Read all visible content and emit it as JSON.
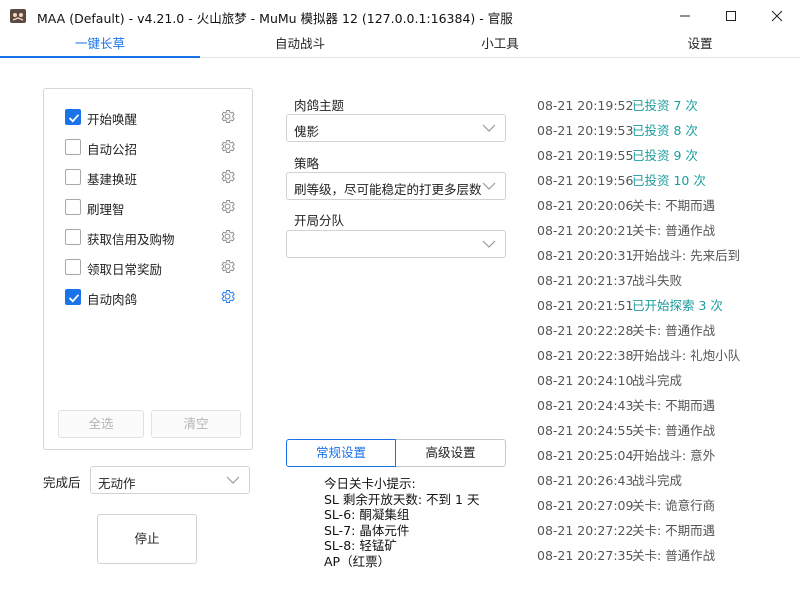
{
  "window": {
    "title": "MAA (Default) - v4.21.0 - 火山旅梦 - MuMu 模拟器 12 (127.0.0.1:16384) - 官服"
  },
  "tabs": [
    {
      "label": "一键长草",
      "active": true
    },
    {
      "label": "自动战斗"
    },
    {
      "label": "小工具"
    },
    {
      "label": "设置"
    }
  ],
  "tasks": [
    {
      "label": "开始唤醒",
      "checked": true
    },
    {
      "label": "自动公招",
      "checked": false
    },
    {
      "label": "基建换班",
      "checked": false
    },
    {
      "label": "刷理智",
      "checked": false
    },
    {
      "label": "获取信用及购物",
      "checked": false
    },
    {
      "label": "领取日常奖励",
      "checked": false
    },
    {
      "label": "自动肉鸽",
      "checked": true
    }
  ],
  "task_buttons": {
    "select_all": "全选",
    "clear": "清空"
  },
  "after_completion": {
    "label": "完成后",
    "value": "无动作"
  },
  "stop_button": "停止",
  "roguelike": {
    "theme_label": "肉鸽主题",
    "theme_value": "傀影",
    "strategy_label": "策略",
    "strategy_value": "刷等级，尽可能稳定的打更多层数",
    "squad_label": "开局分队",
    "squad_value": ""
  },
  "settings_tabs": {
    "normal": "常规设置",
    "advanced": "高级设置"
  },
  "tips": {
    "title": "今日关卡小提示:",
    "lines": [
      "SL 剩余开放天数: 不到 1 天",
      "SL-6: 酮凝集组",
      "SL-7: 晶体元件",
      "SL-8: 轻锰矿",
      "AP（红票）"
    ]
  },
  "log": [
    {
      "time": "08-21  20:19:52",
      "msg": "已投资 7 次",
      "highlight": true
    },
    {
      "time": "08-21  20:19:53",
      "msg": "已投资 8 次",
      "highlight": true
    },
    {
      "time": "08-21  20:19:55",
      "msg": "已投资 9 次",
      "highlight": true
    },
    {
      "time": "08-21  20:19:56",
      "msg": "已投资 10 次",
      "highlight": true
    },
    {
      "time": "08-21  20:20:06",
      "msg": "关卡: 不期而遇",
      "highlight": false
    },
    {
      "time": "08-21  20:20:21",
      "msg": "关卡: 普通作战",
      "highlight": false
    },
    {
      "time": "08-21  20:20:31",
      "msg": "开始战斗: 先来后到",
      "highlight": false
    },
    {
      "time": "08-21  20:21:37",
      "msg": "战斗失败",
      "highlight": false
    },
    {
      "time": "08-21  20:21:51",
      "msg": "已开始探索 3 次",
      "highlight": true
    },
    {
      "time": "08-21  20:22:28",
      "msg": "关卡: 普通作战",
      "highlight": false
    },
    {
      "time": "08-21  20:22:38",
      "msg": "开始战斗: 礼炮小队",
      "highlight": false
    },
    {
      "time": "08-21  20:24:10",
      "msg": "战斗完成",
      "highlight": false
    },
    {
      "time": "08-21  20:24:43",
      "msg": "关卡: 不期而遇",
      "highlight": false
    },
    {
      "time": "08-21  20:24:55",
      "msg": "关卡: 普通作战",
      "highlight": false
    },
    {
      "time": "08-21  20:25:04",
      "msg": "开始战斗: 意外",
      "highlight": false
    },
    {
      "time": "08-21  20:26:43",
      "msg": "战斗完成",
      "highlight": false
    },
    {
      "time": "08-21  20:27:09",
      "msg": "关卡: 诡意行商",
      "highlight": false
    },
    {
      "time": "08-21  20:27:22",
      "msg": "关卡: 不期而遇",
      "highlight": false
    },
    {
      "time": "08-21  20:27:35",
      "msg": "关卡: 普通作战",
      "highlight": false
    }
  ],
  "colors": {
    "accent": "#1a73e8",
    "log_highlight": "#1a9c9c"
  }
}
